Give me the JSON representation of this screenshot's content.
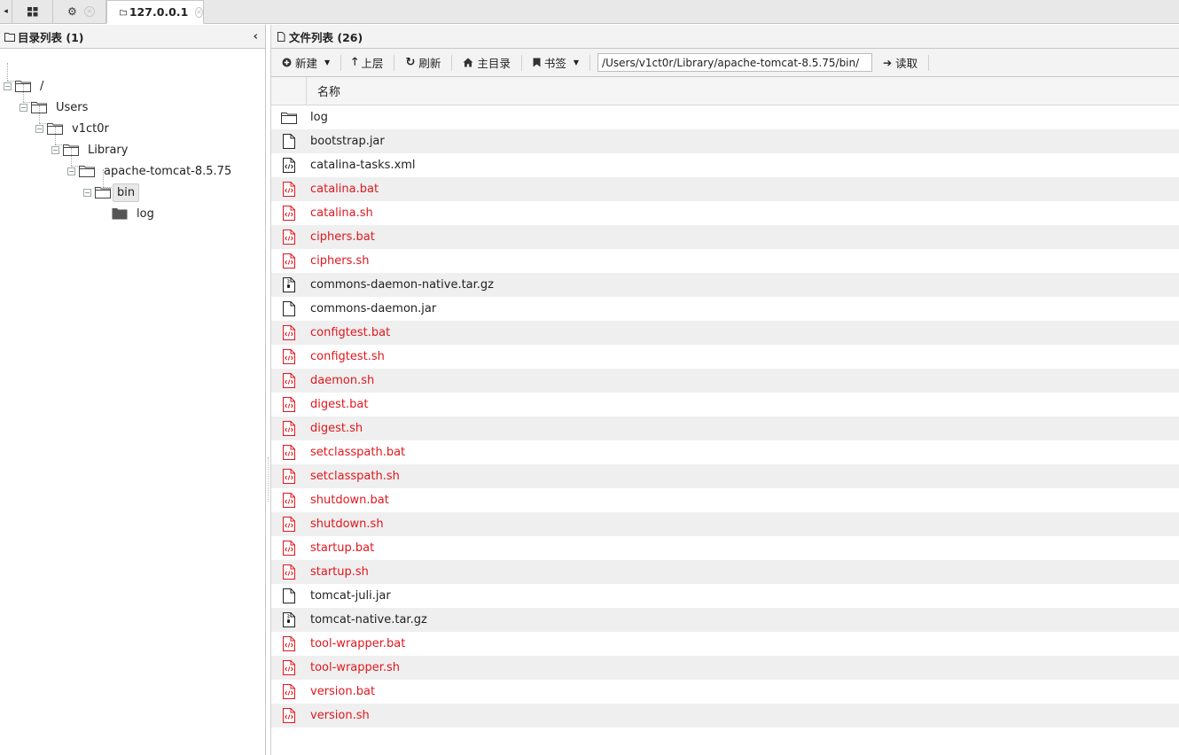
{
  "tabs": {
    "left_arrow": "◂",
    "home_icon": "grid-icon",
    "settings_icon": "gear-icon",
    "active_label": "127.0.0.1",
    "close_glyph": "×"
  },
  "left_panel": {
    "title": "目录列表 (1)",
    "collapse_glyph": "‹",
    "tree": [
      "/",
      "Users",
      "v1ct0r",
      "Library",
      "apache-tomcat-8.5.75",
      "bin",
      "log"
    ]
  },
  "right_panel": {
    "title": "文件列表 (26)",
    "toolbar": {
      "new_label": "新建",
      "up_label": "上层",
      "refresh_label": "刷新",
      "home_label": "主目录",
      "bookmark_label": "书签",
      "path_value": "/Users/v1ct0r/Library/apache-tomcat-8.5.75/bin/",
      "read_label": "读取"
    },
    "column_name": "名称",
    "files": [
      {
        "name": "log",
        "type": "folder",
        "red": false
      },
      {
        "name": "bootstrap.jar",
        "type": "file",
        "red": false
      },
      {
        "name": "catalina-tasks.xml",
        "type": "code",
        "red": false
      },
      {
        "name": "catalina.bat",
        "type": "code",
        "red": true
      },
      {
        "name": "catalina.sh",
        "type": "code",
        "red": true
      },
      {
        "name": "ciphers.bat",
        "type": "code",
        "red": true
      },
      {
        "name": "ciphers.sh",
        "type": "code",
        "red": true
      },
      {
        "name": "commons-daemon-native.tar.gz",
        "type": "archive",
        "red": false
      },
      {
        "name": "commons-daemon.jar",
        "type": "file",
        "red": false
      },
      {
        "name": "configtest.bat",
        "type": "code",
        "red": true
      },
      {
        "name": "configtest.sh",
        "type": "code",
        "red": true
      },
      {
        "name": "daemon.sh",
        "type": "code",
        "red": true
      },
      {
        "name": "digest.bat",
        "type": "code",
        "red": true
      },
      {
        "name": "digest.sh",
        "type": "code",
        "red": true
      },
      {
        "name": "setclasspath.bat",
        "type": "code",
        "red": true
      },
      {
        "name": "setclasspath.sh",
        "type": "code",
        "red": true
      },
      {
        "name": "shutdown.bat",
        "type": "code",
        "red": true
      },
      {
        "name": "shutdown.sh",
        "type": "code",
        "red": true
      },
      {
        "name": "startup.bat",
        "type": "code",
        "red": true
      },
      {
        "name": "startup.sh",
        "type": "code",
        "red": true
      },
      {
        "name": "tomcat-juli.jar",
        "type": "file",
        "red": false
      },
      {
        "name": "tomcat-native.tar.gz",
        "type": "archive",
        "red": false
      },
      {
        "name": "tool-wrapper.bat",
        "type": "code",
        "red": true
      },
      {
        "name": "tool-wrapper.sh",
        "type": "code",
        "red": true
      },
      {
        "name": "version.bat",
        "type": "code",
        "red": true
      },
      {
        "name": "version.sh",
        "type": "code",
        "red": true
      }
    ]
  },
  "colors": {
    "executable_text": "#e0171e",
    "normal_text": "#222222"
  }
}
